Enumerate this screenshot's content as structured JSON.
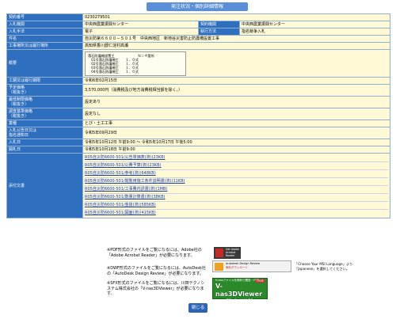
{
  "page_title": "発注状況・個別詳細情報",
  "rows": [
    {
      "label": "契約番号",
      "value": "0230279501"
    },
    {
      "label": "入札機関",
      "value": "中央西農業振興センター",
      "label2": "契約機関",
      "value2": "中央西農業振興センター"
    },
    {
      "label": "入札手法",
      "value": "電子",
      "label2": "執行方法",
      "value2": "指名競争入札"
    },
    {
      "label": "件名",
      "value": "自災防第６６００－５０１号　中央西地区　新地谷災害防止防護柵設置工事"
    },
    {
      "label": "工事場所又は履行場所",
      "value": "高知県香川郡仁淀村高瀬"
    }
  ],
  "summary": {
    "label": "概要",
    "lines": [
      "落石防護柵設置工　　　　　　　Ｎ＝４箇所",
      "　01号落石防護柵工　　１．０式",
      "　02号落石防護柵工　　１．０式",
      "　03号落石防護柵工　　１．０式",
      "　04号落石防護柵工　　１．０式"
    ]
  },
  "rows2": [
    {
      "label": "工期又は履行期限",
      "value": "令和6年02月15日"
    },
    {
      "label": "予定価格\n（税抜き）",
      "value": "3,570,000円（消費税及び地方消費税相当額を除く。）"
    },
    {
      "label": "最低制限価格\n（税抜き）",
      "value": "設定あり"
    },
    {
      "label": "調査基準価格\n（税抜き）",
      "value": "設定なし"
    },
    {
      "label": "業種",
      "value": "とび・土工工事"
    },
    {
      "label": "入札公告日又は\n指名通知日",
      "value": "令和5年09月29日"
    },
    {
      "label": "入札日",
      "value": "令和5年10月12日 午前9:00 〜 令和5年10月17日 午後5:00"
    },
    {
      "label": "開札日",
      "value": "令和5年10月18日 午前9:00"
    }
  ],
  "attachments": {
    "label": "添付文書",
    "files": [
      "R05自災防6600-501/公告単価表(済)(23KB)",
      "R05自災防6600-501/公費予算(済)(23KB)",
      "R05自災防6600-501/参考(済)(648KB)",
      "R05自災防6600-501/閲覧用施工条件説明書(済)(11KB)",
      "R05自災防6600-501/工事費内訳書(済)(1MB)",
      "R05自災防6600-501/数量計算書(済)(38KB)",
      "R05自災防6600-501/金抜(済)(585KB)",
      "R05自災防6600-501/図面(済)(415KB)"
    ]
  },
  "notes": [
    "※PDF形式のファイルをご覧になるには、Adobe社の「Adobe Acrobat Reader」が必要になります。",
    "※DWF形式のファイルをご覧になるには、AutoDesk社の「AutoDesk Design Review」が必要になります。",
    "※SFX形式のファイルをご覧になるには、川田テクノシステム株式会社の「V-nas3DViewer」が必要になります。"
  ],
  "badges": {
    "adobe_top": "Get Adobe",
    "adobe_bottom": "Acrobat Reader",
    "autodesk_line1": "Autodesk Design Review",
    "autodesk_line2": "無料ダウンロード",
    "autodesk_hint1": "「Choose Your MSI Language」より",
    "autodesk_hint2": "「Japanese」を選択してください。",
    "vnas_top": "V-nasファイルを無料で閲覧・印刷",
    "vnas_brand": "V-nas3DViewer",
    "vnas_bottom": "ダウンロードはこちら",
    "vnas_free": "FREE"
  },
  "close_label": "閉じる",
  "colors": {
    "header_cell": "#2f6fbf",
    "value_cell": "#fff9d6",
    "title_tab": "#5a8ed6"
  }
}
